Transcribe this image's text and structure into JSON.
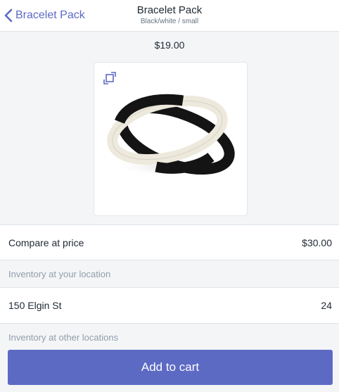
{
  "nav": {
    "back_label": "Bracelet Pack",
    "title": "Bracelet Pack",
    "subtitle": "Black/white / small"
  },
  "product": {
    "price": "$19.00",
    "image_icon": "expand-icon"
  },
  "compare_price": {
    "label": "Compare at price",
    "value": "$30.00"
  },
  "inventory": {
    "your_location_header": "Inventory at your location",
    "location_name": "150 Elgin St",
    "location_count": "24",
    "other_locations_header": "Inventory at other locations"
  },
  "cta": {
    "add_to_cart_label": "Add to cart"
  },
  "colors": {
    "accent": "#5c6ac4",
    "background": "#f4f5f7",
    "text": "#212b36",
    "muted": "#919eab"
  }
}
